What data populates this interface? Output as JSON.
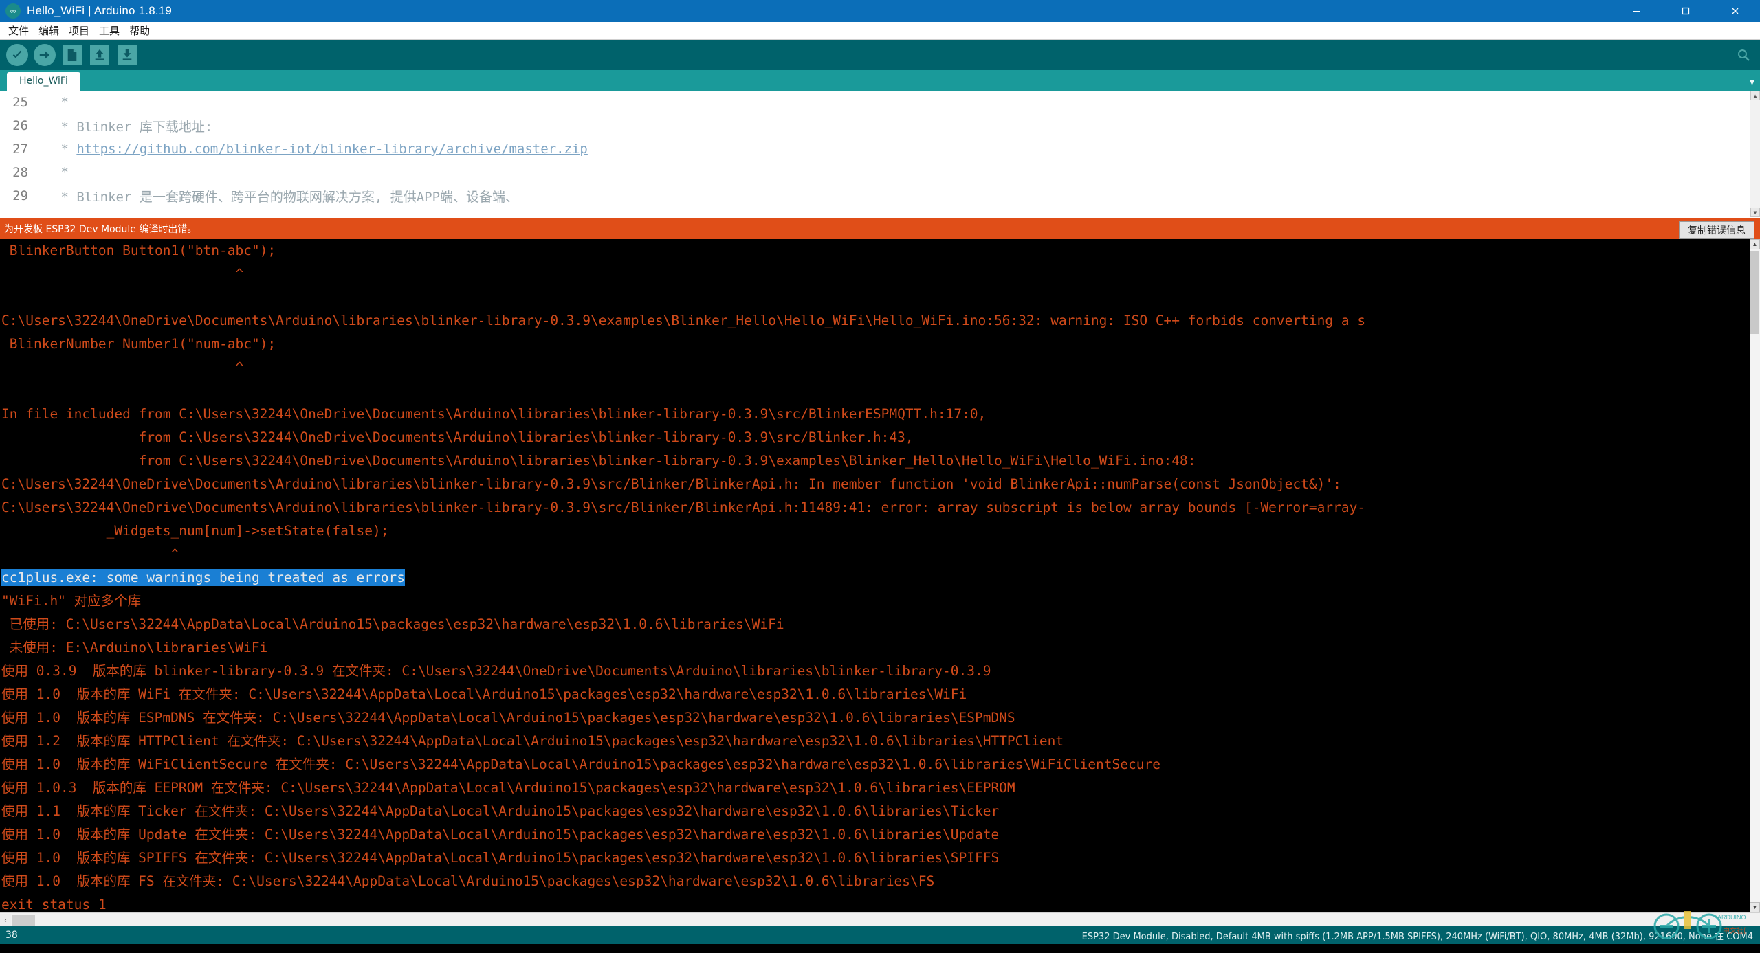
{
  "window": {
    "title": "Hello_WiFi | Arduino 1.8.19",
    "logo_glyph": "∞",
    "minimize_label": "—",
    "maximize_label": "▢",
    "close_label": "✕"
  },
  "menubar": {
    "items": [
      {
        "label": "文件"
      },
      {
        "label": "编辑"
      },
      {
        "label": "项目"
      },
      {
        "label": "工具"
      },
      {
        "label": "帮助"
      }
    ]
  },
  "toolbar": {
    "buttons": [
      {
        "name": "verify-button",
        "icon": "check-icon",
        "label": "验证"
      },
      {
        "name": "upload-button",
        "icon": "arrow-right-icon",
        "label": "上传"
      },
      {
        "name": "new-button",
        "icon": "new-file-icon",
        "label": "新建"
      },
      {
        "name": "open-button",
        "icon": "arrow-up-icon",
        "label": "打开"
      },
      {
        "name": "save-button",
        "icon": "arrow-down-icon",
        "label": "保存"
      }
    ],
    "serial_monitor_icon": "serial-monitor-icon"
  },
  "tabs": {
    "items": [
      {
        "label": "Hello_WiFi",
        "active": true
      }
    ],
    "dropdown_glyph": "▾"
  },
  "editor": {
    "lines": [
      {
        "number": "25",
        "text": " *",
        "link": ""
      },
      {
        "number": "26",
        "text": " * Blinker 库下载地址:",
        "link": ""
      },
      {
        "number": "27",
        "text": " * ",
        "link": "https://github.com/blinker-iot/blinker-library/archive/master.zip"
      },
      {
        "number": "28",
        "text": " *",
        "link": ""
      },
      {
        "number": "29",
        "text": " * Blinker 是一套跨硬件、跨平台的物联网解决方案, 提供APP端、设备端、",
        "link": ""
      }
    ],
    "scroll_up_glyph": "▲",
    "scroll_down_glyph": "▼"
  },
  "error_bar": {
    "message": "为开发板 ESP32 Dev Module 编译时出错。",
    "copy_button_label": "复制错误信息"
  },
  "console": {
    "lines": [
      {
        "text": " BlinkerButton Button1(\"btn-abc\");",
        "style": "normal"
      },
      {
        "text": "                             ^",
        "style": "normal"
      },
      {
        "text": "",
        "style": "normal"
      },
      {
        "text": "C:\\Users\\32244\\OneDrive\\Documents\\Arduino\\libraries\\blinker-library-0.3.9\\examples\\Blinker_Hello\\Hello_WiFi\\Hello_WiFi.ino:56:32: warning: ISO C++ forbids converting a s",
        "style": "normal"
      },
      {
        "text": " BlinkerNumber Number1(\"num-abc\");",
        "style": "normal"
      },
      {
        "text": "                             ^",
        "style": "normal"
      },
      {
        "text": "",
        "style": "normal"
      },
      {
        "text": "In file included from C:\\Users\\32244\\OneDrive\\Documents\\Arduino\\libraries\\blinker-library-0.3.9\\src/BlinkerESPMQTT.h:17:0,",
        "style": "normal"
      },
      {
        "text": "                 from C:\\Users\\32244\\OneDrive\\Documents\\Arduino\\libraries\\blinker-library-0.3.9\\src/Blinker.h:43,",
        "style": "normal"
      },
      {
        "text": "                 from C:\\Users\\32244\\OneDrive\\Documents\\Arduino\\libraries\\blinker-library-0.3.9\\examples\\Blinker_Hello\\Hello_WiFi\\Hello_WiFi.ino:48:",
        "style": "normal"
      },
      {
        "text": "C:\\Users\\32244\\OneDrive\\Documents\\Arduino\\libraries\\blinker-library-0.3.9\\src/Blinker/BlinkerApi.h: In member function 'void BlinkerApi::numParse(const JsonObject&)':",
        "style": "normal"
      },
      {
        "text": "C:\\Users\\32244\\OneDrive\\Documents\\Arduino\\libraries\\blinker-library-0.3.9\\src/Blinker/BlinkerApi.h:11489:41: error: array subscript is below array bounds [-Werror=array-",
        "style": "normal"
      },
      {
        "text": "             _Widgets_num[num]->setState(false);",
        "style": "normal"
      },
      {
        "text": "                     ^",
        "style": "normal"
      },
      {
        "text": "cc1plus.exe: some warnings being treated as errors",
        "style": "selected"
      },
      {
        "text": "\"WiFi.h\" 对应多个库",
        "style": "normal"
      },
      {
        "text": " 已使用: C:\\Users\\32244\\AppData\\Local\\Arduino15\\packages\\esp32\\hardware\\esp32\\1.0.6\\libraries\\WiFi",
        "style": "normal"
      },
      {
        "text": " 未使用: E:\\Arduino\\libraries\\WiFi",
        "style": "normal"
      },
      {
        "text": "使用 0.3.9  版本的库 blinker-library-0.3.9 在文件夹: C:\\Users\\32244\\OneDrive\\Documents\\Arduino\\libraries\\blinker-library-0.3.9",
        "style": "normal"
      },
      {
        "text": "使用 1.0  版本的库 WiFi 在文件夹: C:\\Users\\32244\\AppData\\Local\\Arduino15\\packages\\esp32\\hardware\\esp32\\1.0.6\\libraries\\WiFi",
        "style": "normal"
      },
      {
        "text": "使用 1.0  版本的库 ESPmDNS 在文件夹: C:\\Users\\32244\\AppData\\Local\\Arduino15\\packages\\esp32\\hardware\\esp32\\1.0.6\\libraries\\ESPmDNS",
        "style": "normal"
      },
      {
        "text": "使用 1.2  版本的库 HTTPClient 在文件夹: C:\\Users\\32244\\AppData\\Local\\Arduino15\\packages\\esp32\\hardware\\esp32\\1.0.6\\libraries\\HTTPClient",
        "style": "normal"
      },
      {
        "text": "使用 1.0  版本的库 WiFiClientSecure 在文件夹: C:\\Users\\32244\\AppData\\Local\\Arduino15\\packages\\esp32\\hardware\\esp32\\1.0.6\\libraries\\WiFiClientSecure",
        "style": "normal"
      },
      {
        "text": "使用 1.0.3  版本的库 EEPROM 在文件夹: C:\\Users\\32244\\AppData\\Local\\Arduino15\\packages\\esp32\\hardware\\esp32\\1.0.6\\libraries\\EEPROM",
        "style": "normal"
      },
      {
        "text": "使用 1.1  版本的库 Ticker 在文件夹: C:\\Users\\32244\\AppData\\Local\\Arduino15\\packages\\esp32\\hardware\\esp32\\1.0.6\\libraries\\Ticker",
        "style": "normal"
      },
      {
        "text": "使用 1.0  版本的库 Update 在文件夹: C:\\Users\\32244\\AppData\\Local\\Arduino15\\packages\\esp32\\hardware\\esp32\\1.0.6\\libraries\\Update",
        "style": "normal"
      },
      {
        "text": "使用 1.0  版本的库 SPIFFS 在文件夹: C:\\Users\\32244\\AppData\\Local\\Arduino15\\packages\\esp32\\hardware\\esp32\\1.0.6\\libraries\\SPIFFS",
        "style": "normal"
      },
      {
        "text": "使用 1.0  版本的库 FS 在文件夹: C:\\Users\\32244\\AppData\\Local\\Arduino15\\packages\\esp32\\hardware\\esp32\\1.0.6\\libraries\\FS",
        "style": "normal"
      },
      {
        "text": "exit status 1",
        "style": "normal"
      },
      {
        "text": "为开发板 ESP32 Dev Module 编译时出错。",
        "style": "normal"
      }
    ],
    "scroll_up_glyph": "▲",
    "scroll_down_glyph": "▼"
  },
  "hscroll": {
    "left_glyph": "‹",
    "right_glyph": "›"
  },
  "statusbar": {
    "line_number": "38",
    "board_info": "ESP32 Dev Module, Disabled, Default 4MB with spiffs (1.2MB APP/1.5MB SPIFFS), 240MHz (WiFi/BT), QIO, 80MHz, 4MB (32Mb), 921600, None 在 COM4"
  },
  "colors": {
    "title_blue": "#0b6eb8",
    "teal_dark": "#00626b",
    "teal_mid": "#1a9a9a",
    "teal_light": "#4aa6a6",
    "error_orange": "#e04e18",
    "console_red": "#cf4a1a",
    "selection_blue": "#1a7fd4"
  }
}
